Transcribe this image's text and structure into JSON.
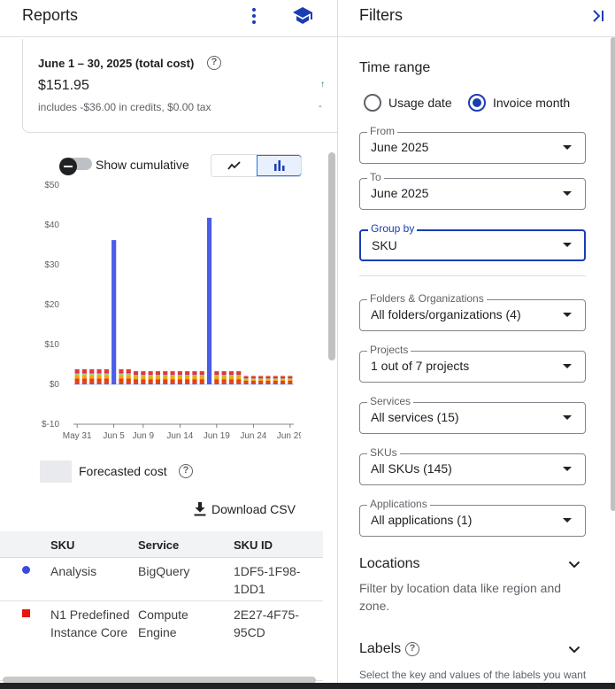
{
  "reports": {
    "title": "Reports",
    "more_icon": "more-vert-icon",
    "school_icon": "school-icon"
  },
  "cost_card": {
    "period": "June 1 – 30, 2025 (total cost)",
    "total": "$151.95",
    "subtext": "includes -$36.00 in credits, $0.00 tax"
  },
  "controls": {
    "cumulative_label": "Show cumulative",
    "cumulative_on": false,
    "view_selected": "bar"
  },
  "chart_data": {
    "type": "bar",
    "stacked": true,
    "y_tick_labels": [
      "$50",
      "$40",
      "$30",
      "$20",
      "$10",
      "$0",
      "$-10"
    ],
    "y_ticks": [
      50,
      40,
      30,
      20,
      10,
      0,
      -10
    ],
    "ylim": [
      -10,
      50
    ],
    "x_tick_labels": [
      "May 31",
      "Jun 5",
      "Jun 9",
      "Jun 14",
      "Jun 19",
      "Jun 24",
      "Jun 29"
    ],
    "x_tick_index": [
      0,
      5,
      9,
      14,
      19,
      24,
      29
    ],
    "days": 30,
    "series": [
      {
        "color": "#4a5ce8",
        "values": [
          0.3,
          0.3,
          0.3,
          0.3,
          0.3,
          36.2,
          0.3,
          0.3,
          0.3,
          0.3,
          0.3,
          0.3,
          0.3,
          0.3,
          0.3,
          0.3,
          0.3,
          0.3,
          41.8,
          0.3,
          0.3,
          0.3,
          0.3,
          0.3,
          0.3,
          0.3,
          0.3,
          0.3,
          0.3,
          0.3
        ]
      },
      {
        "color": "#e8400c",
        "values": [
          1.2,
          1.2,
          1.2,
          1.2,
          1.2,
          0,
          1.2,
          1.2,
          1.0,
          1.0,
          1.0,
          1.0,
          1.0,
          1.0,
          1.0,
          1.0,
          1.0,
          1.0,
          0,
          1.0,
          1.0,
          1.0,
          1.0,
          0.6,
          0.6,
          0.6,
          0.6,
          0.6,
          0.6,
          0.6
        ]
      },
      {
        "color": "#f6a700",
        "values": [
          0.8,
          0.8,
          0.8,
          0.8,
          0.8,
          0,
          0.8,
          0.8,
          0.7,
          0.7,
          0.7,
          0.7,
          0.7,
          0.7,
          0.7,
          0.7,
          0.7,
          0.7,
          0,
          0.7,
          0.7,
          0.7,
          0.7,
          0.4,
          0.4,
          0.4,
          0.4,
          0.4,
          0.4,
          0.4
        ]
      },
      {
        "color": "#9ccc65",
        "values": [
          0.5,
          0.5,
          0.5,
          0.5,
          0.5,
          0,
          0.5,
          0.5,
          0.4,
          0.4,
          0.4,
          0.4,
          0.4,
          0.4,
          0.4,
          0.4,
          0.4,
          0.4,
          0,
          0.4,
          0.4,
          0.4,
          0.4,
          0.2,
          0.2,
          0.2,
          0.2,
          0.2,
          0.2,
          0.2
        ]
      },
      {
        "color": "#d81b60",
        "values": [
          0.4,
          0.4,
          0.4,
          0.4,
          0.4,
          0,
          0.4,
          0.4,
          0.4,
          0.4,
          0.4,
          0.4,
          0.4,
          0.4,
          0.4,
          0.4,
          0.4,
          0.4,
          0,
          0.4,
          0.4,
          0.4,
          0.4,
          0.3,
          0.3,
          0.3,
          0.3,
          0.3,
          0.3,
          0.3
        ]
      },
      {
        "color": "#e53935",
        "values": [
          0.6,
          0.6,
          0.6,
          0.6,
          0.6,
          0,
          0.6,
          0.6,
          0.5,
          0.5,
          0.5,
          0.5,
          0.5,
          0.5,
          0.5,
          0.5,
          0.5,
          0.5,
          0,
          0.5,
          0.5,
          0.5,
          0.5,
          0.3,
          0.3,
          0.3,
          0.3,
          0.3,
          0.3,
          0.3
        ]
      }
    ]
  },
  "forecast": {
    "label": "Forecasted cost"
  },
  "download": {
    "label": "Download CSV"
  },
  "table": {
    "columns": [
      "SKU",
      "Service",
      "SKU ID"
    ],
    "rows": [
      {
        "marker": "circle",
        "marker_color": "#3b4ad9",
        "sku": "Analysis",
        "service": "BigQuery",
        "sku_id": "1DF5-1F98-1DD1"
      },
      {
        "marker": "square",
        "marker_color": "#e8170c",
        "sku": "N1 Predefined Instance Core",
        "service": "Compute Engine",
        "sku_id": "2E27-4F75-95CD"
      }
    ]
  },
  "filters": {
    "title": "Filters",
    "collapse_icon": "last-page-icon",
    "time_range": {
      "title": "Time range",
      "options": [
        "Usage date",
        "Invoice month"
      ],
      "selected": "Invoice month"
    },
    "from": {
      "label": "From",
      "value": "June 2025"
    },
    "to": {
      "label": "To",
      "value": "June 2025"
    },
    "group_by": {
      "label": "Group by",
      "value": "SKU"
    },
    "folders": {
      "label": "Folders & Organizations",
      "value": "All folders/organizations (4)"
    },
    "projects": {
      "label": "Projects",
      "value": "1 out of 7 projects"
    },
    "services": {
      "label": "Services",
      "value": "All services (15)"
    },
    "skus": {
      "label": "SKUs",
      "value": "All SKUs (145)"
    },
    "applications": {
      "label": "Applications",
      "value": "All applications (1)"
    },
    "locations": {
      "title": "Locations",
      "desc": "Filter by location data like region and zone."
    },
    "labels": {
      "title": "Labels",
      "desc": "Select the key and values of the labels you want"
    }
  }
}
